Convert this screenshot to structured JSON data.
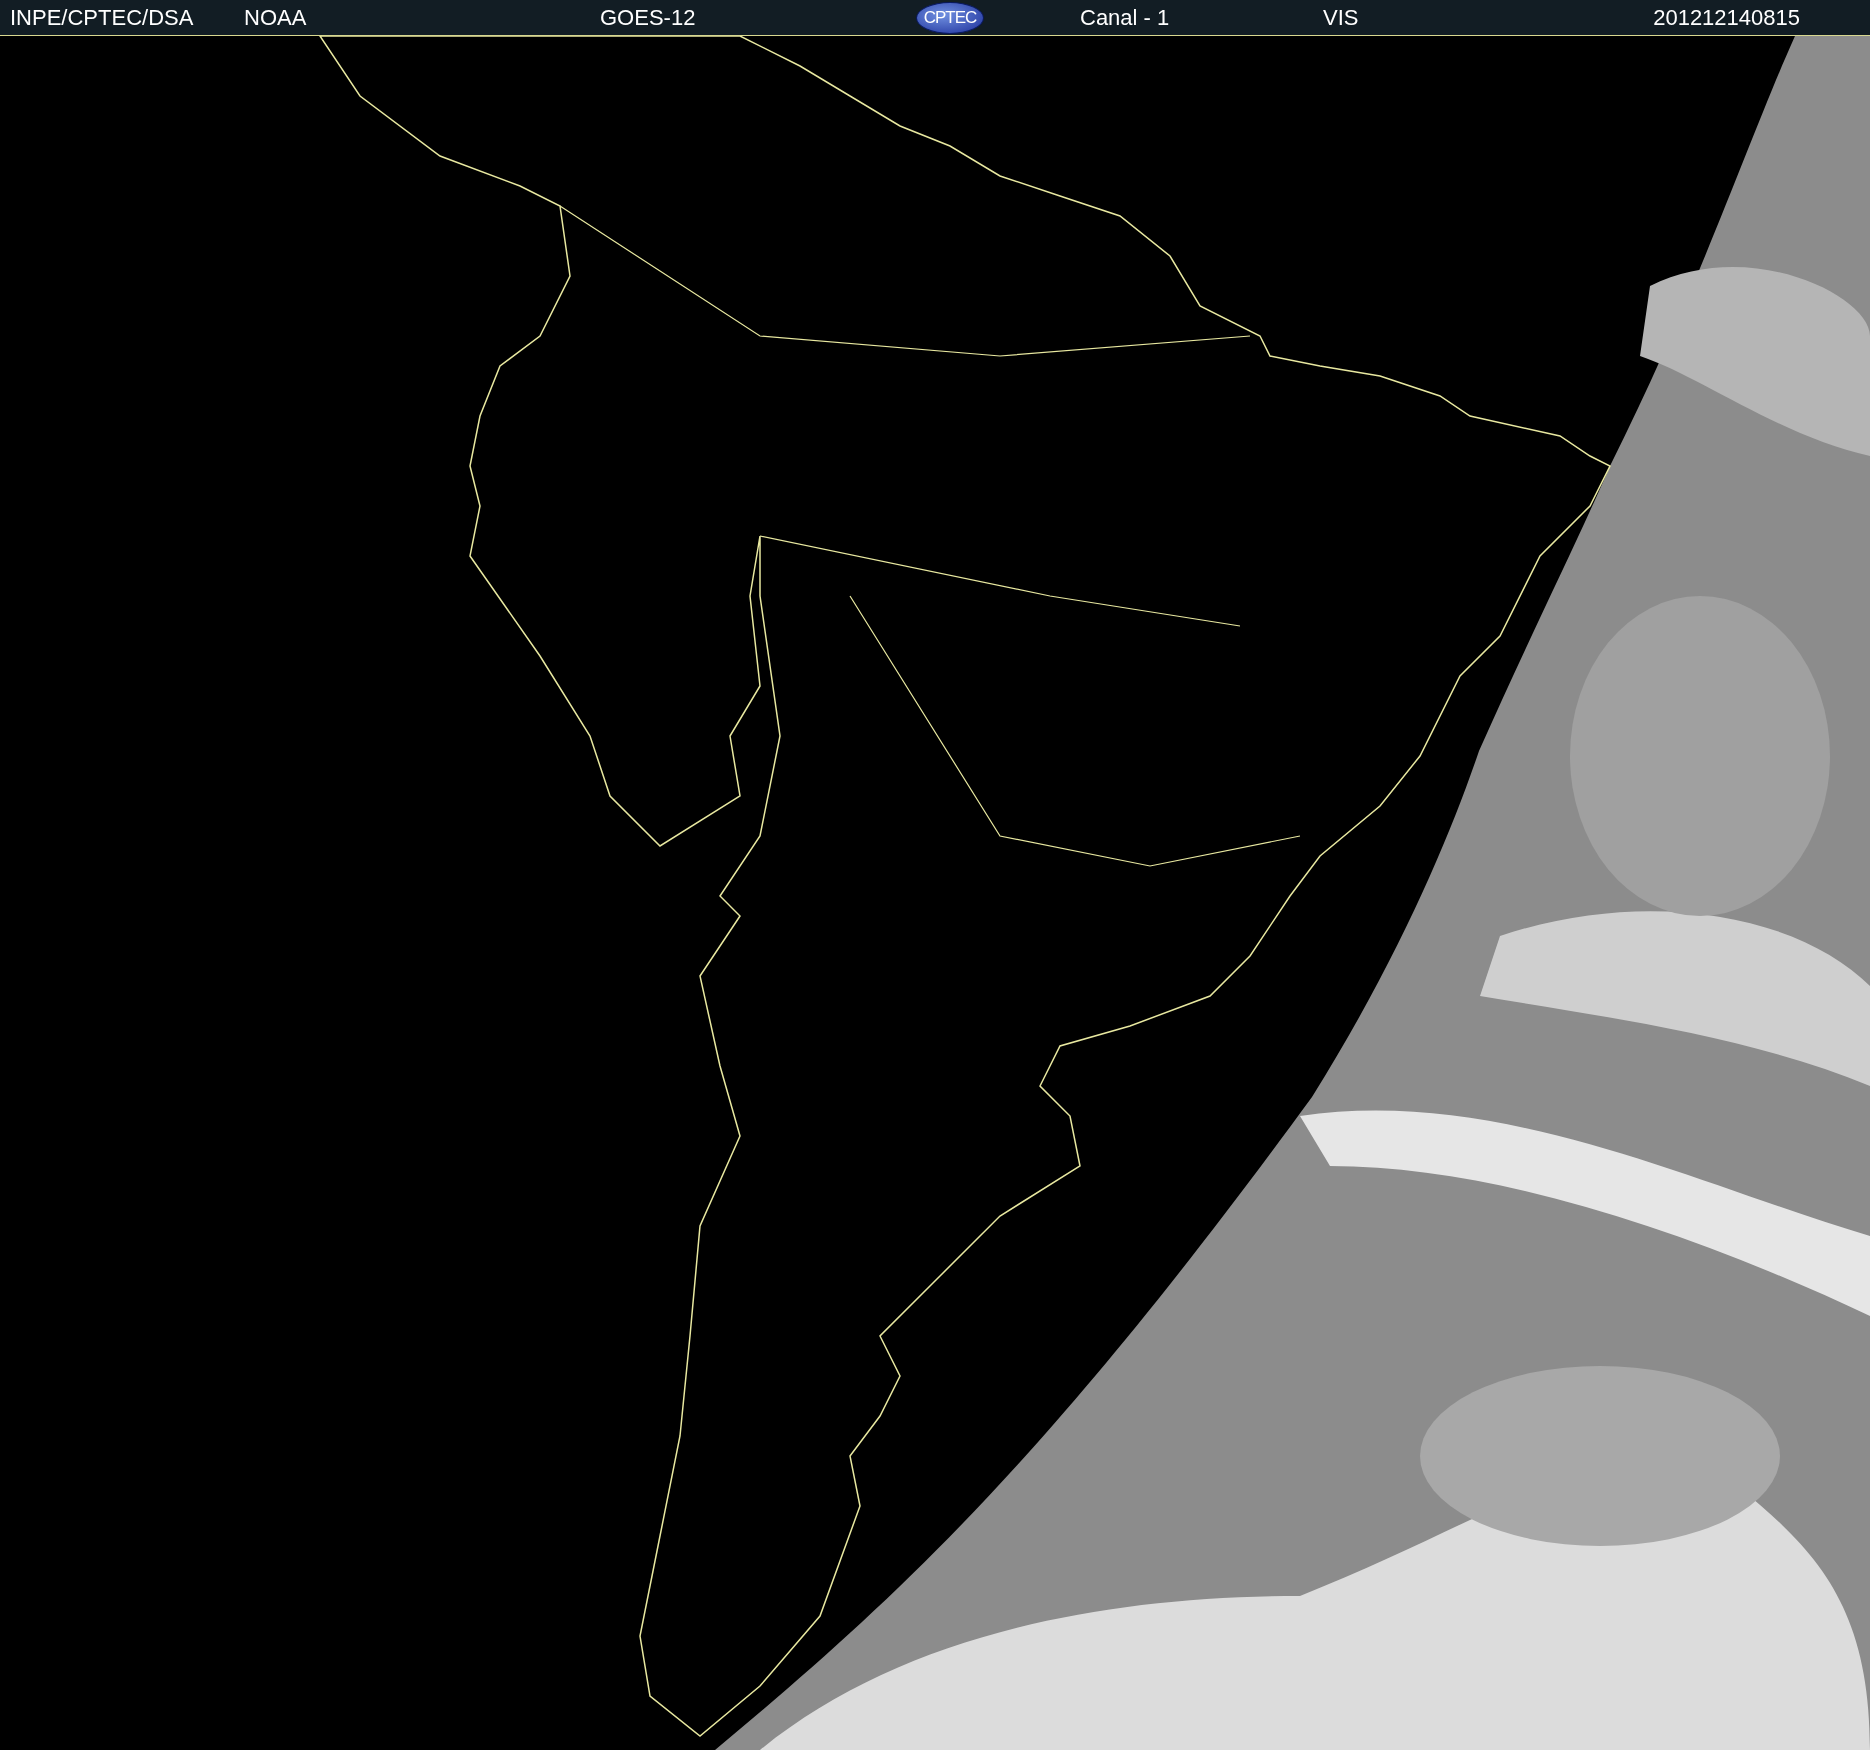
{
  "header": {
    "items": [
      {
        "kind": "text",
        "text": "INPE/CPTEC/DSA"
      },
      {
        "kind": "text",
        "text": "NOAA"
      },
      {
        "kind": "text",
        "text": "GOES-12"
      },
      {
        "kind": "logo",
        "text": "CPTEC"
      },
      {
        "kind": "text",
        "text": "Canal - 1"
      },
      {
        "kind": "text",
        "text": "VIS"
      },
      {
        "kind": "text",
        "text": "201212140815"
      }
    ]
  }
}
